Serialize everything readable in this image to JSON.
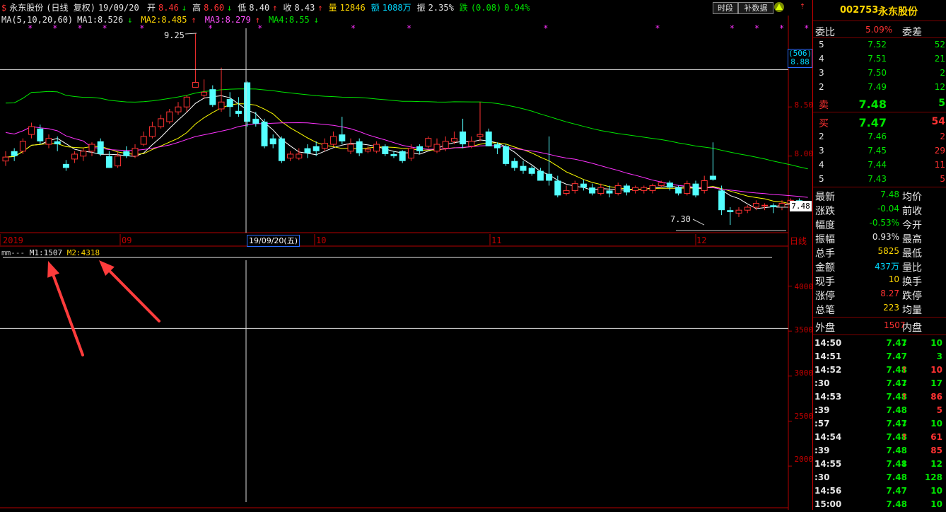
{
  "info": {
    "stock_name": "永东股份",
    "period": "(日线 复权)",
    "date": "19/09/20",
    "open_label": "开",
    "open": "8.46",
    "open_arrow": "↓",
    "high_label": "高",
    "high": "8.60",
    "high_arrow": "↓",
    "low_label": "低",
    "low": "8.40",
    "low_arrow": "↑",
    "close_label": "收",
    "close": "8.43",
    "close_arrow": "↑",
    "vol_label": "量",
    "vol": "12846",
    "amt_label": "额",
    "amt": "1088万",
    "amp_label": "振",
    "amp": "2.35%",
    "fall_label": "跌",
    "fall": "(0.08)",
    "fall_pct": "0.94%"
  },
  "ma_line": {
    "header": "MA(5,10,20,60)",
    "ma1": "MA1:8.526",
    "ma1_arrow": "↓",
    "ma2": "MA2:8.485",
    "ma2_arrow": "↑",
    "ma3": "MA3:8.279",
    "ma3_arrow": "↑",
    "ma4": "MA4:8.55",
    "ma4_arrow": "↓"
  },
  "buttons": {
    "time_share": "时段",
    "supplement": "补数据"
  },
  "price_annotations": {
    "high_mark": "9.25",
    "low_mark": "7.30",
    "cur_price": "7.48",
    "cursor_count": "(506)",
    "cursor_price": "8.88"
  },
  "price_axis": [
    "8.50",
    "8.00"
  ],
  "x_axis": {
    "year": "2019",
    "m09": "09",
    "cursor_date": "19/09/20(五)",
    "m10": "10",
    "m11": "11",
    "m12": "12",
    "mode": "日线"
  },
  "indicator": {
    "name": "mm---",
    "m1": "M1:1507",
    "m2": "M2:4318"
  },
  "vol_axis": [
    "4000",
    "3500",
    "3000",
    "2500",
    "2000"
  ],
  "right": {
    "code": "002753",
    "name": "永东股份",
    "weibi_label": "委比",
    "weibi": "5.09%",
    "weicha_label": "委差",
    "asks": [
      {
        "lvl": "5",
        "price": "7.52",
        "vol": "52"
      },
      {
        "lvl": "4",
        "price": "7.51",
        "vol": "21"
      },
      {
        "lvl": "3",
        "price": "7.50",
        "vol": "2"
      },
      {
        "lvl": "2",
        "price": "7.49",
        "vol": "12"
      },
      {
        "lvl": "卖",
        "price": "7.48",
        "vol": "5"
      }
    ],
    "bids": [
      {
        "lvl": "买",
        "price": "7.47",
        "vol": "54"
      },
      {
        "lvl": "2",
        "price": "7.46",
        "vol": "2"
      },
      {
        "lvl": "3",
        "price": "7.45",
        "vol": "29"
      },
      {
        "lvl": "4",
        "price": "7.44",
        "vol": "11"
      },
      {
        "lvl": "5",
        "price": "7.43",
        "vol": "5"
      }
    ],
    "stats": [
      {
        "l": "最新",
        "v": "7.48",
        "c": "green",
        "r": "均价"
      },
      {
        "l": "涨跌",
        "v": "-0.04",
        "c": "green",
        "r": "前收"
      },
      {
        "l": "幅度",
        "v": "-0.53%",
        "c": "green",
        "r": "今开"
      },
      {
        "l": "振幅",
        "v": "0.93%",
        "c": "white",
        "r": "最高"
      },
      {
        "l": "总手",
        "v": "5825",
        "c": "yellow",
        "r": "最低"
      },
      {
        "l": "金额",
        "v": "437万",
        "c": "cyan",
        "r": "量比"
      },
      {
        "l": "现手",
        "v": "10",
        "c": "yellow",
        "r": "换手"
      },
      {
        "l": "涨停",
        "v": "8.27",
        "c": "red",
        "r": "跌停"
      },
      {
        "l": "总笔",
        "v": "223",
        "c": "yellow",
        "r": "均量"
      }
    ],
    "outer_label": "外盘",
    "outer": "1507",
    "inner_label": "内盘",
    "ticks": [
      {
        "t": "14:50",
        "p": "7.47",
        "pc": "green",
        "a": "↓",
        "ac": "green",
        "v": "10",
        "vc": "green"
      },
      {
        "t": "14:51",
        "p": "7.47",
        "pc": "green",
        "a": "",
        "ac": "green",
        "v": "3",
        "vc": "green"
      },
      {
        "t": "14:52",
        "p": "7.48",
        "pc": "green",
        "a": "↑",
        "ac": "red",
        "v": "10",
        "vc": "red"
      },
      {
        "t": ":30",
        "p": "7.47",
        "pc": "green",
        "a": "↓",
        "ac": "green",
        "v": "17",
        "vc": "green"
      },
      {
        "t": "14:53",
        "p": "7.48",
        "pc": "green",
        "a": "↑",
        "ac": "red",
        "v": "86",
        "vc": "red"
      },
      {
        "t": ":39",
        "p": "7.48",
        "pc": "green",
        "a": "",
        "ac": "red",
        "v": "5",
        "vc": "red"
      },
      {
        "t": ":57",
        "p": "7.47",
        "pc": "green",
        "a": "↓",
        "ac": "green",
        "v": "10",
        "vc": "green"
      },
      {
        "t": "14:54",
        "p": "7.48",
        "pc": "green",
        "a": "↑",
        "ac": "red",
        "v": "61",
        "vc": "red"
      },
      {
        "t": ":39",
        "p": "7.48",
        "pc": "green",
        "a": "",
        "ac": "red",
        "v": "85",
        "vc": "red"
      },
      {
        "t": "14:55",
        "p": "7.48",
        "pc": "green",
        "a": "↓",
        "ac": "green",
        "v": "12",
        "vc": "green"
      },
      {
        "t": ":30",
        "p": "7.48",
        "pc": "green",
        "a": "",
        "ac": "green",
        "v": "128",
        "vc": "green"
      },
      {
        "t": "14:56",
        "p": "7.47",
        "pc": "green",
        "a": "",
        "ac": "green",
        "v": "10",
        "vc": "green"
      },
      {
        "t": "15:00",
        "p": "7.48",
        "pc": "green",
        "a": "",
        "ac": "green",
        "v": "10",
        "vc": "green"
      }
    ]
  },
  "colors": {
    "up": "#ff3232",
    "down": "#54ffff",
    "ma1": "#ffffff",
    "ma2": "#ffff00",
    "ma3": "#ff32ff",
    "ma4": "#00e600",
    "frame": "#b40000",
    "arrow": "#ff3c3c"
  },
  "chart_data": {
    "type": "candlestick",
    "ylim": [
      7.25,
      9.3
    ],
    "candles": [
      [
        7.95,
        7.99,
        7.9,
        8.05
      ],
      [
        8.05,
        8.0,
        7.95,
        8.08
      ],
      [
        8.05,
        8.15,
        8.02,
        8.18
      ],
      [
        8.22,
        8.3,
        8.18,
        8.34
      ],
      [
        8.28,
        8.15,
        8.12,
        8.32
      ],
      [
        8.12,
        8.18,
        8.08,
        8.22
      ],
      [
        8.15,
        8.12,
        8.05,
        8.2
      ],
      [
        7.92,
        7.88,
        7.85,
        7.96
      ],
      [
        7.97,
        8.02,
        7.93,
        8.05
      ],
      [
        8.0,
        8.05,
        7.95,
        8.08
      ],
      [
        8.05,
        8.12,
        8.0,
        8.14
      ],
      [
        8.15,
        8.02,
        8.0,
        8.18
      ],
      [
        8.0,
        7.88,
        7.88,
        8.05
      ],
      [
        7.9,
        8.0,
        7.88,
        8.04
      ],
      [
        8.05,
        8.0,
        7.98,
        8.1
      ],
      [
        8.0,
        8.08,
        7.98,
        8.12
      ],
      [
        8.12,
        8.2,
        8.1,
        8.25
      ],
      [
        8.2,
        8.3,
        8.18,
        8.35
      ],
      [
        8.3,
        8.38,
        8.28,
        8.42
      ],
      [
        8.35,
        8.45,
        8.33,
        8.48
      ],
      [
        8.45,
        8.5,
        8.42,
        8.55
      ],
      [
        8.5,
        8.6,
        8.45,
        8.62
      ],
      [
        8.7,
        8.75,
        8.7,
        9.25
      ],
      [
        8.62,
        8.65,
        8.58,
        8.78
      ],
      [
        8.68,
        8.52,
        8.5,
        8.72
      ],
      [
        8.48,
        8.55,
        8.45,
        8.9
      ],
      [
        8.58,
        8.5,
        8.4,
        8.65
      ],
      [
        8.46,
        8.43,
        8.4,
        8.6
      ],
      [
        8.75,
        8.35,
        8.3,
        8.76
      ],
      [
        8.38,
        8.33,
        8.3,
        8.45
      ],
      [
        8.35,
        8.1,
        8.08,
        8.38
      ],
      [
        8.18,
        8.12,
        8.08,
        8.22
      ],
      [
        8.18,
        7.95,
        7.93,
        8.2
      ],
      [
        7.98,
        8.02,
        7.95,
        8.05
      ],
      [
        7.98,
        8.02,
        7.96,
        8.08
      ],
      [
        8.08,
        8.03,
        7.98,
        8.12
      ],
      [
        8.1,
        8.05,
        8.0,
        8.15
      ],
      [
        8.08,
        8.13,
        8.05,
        8.18
      ],
      [
        8.12,
        8.2,
        8.1,
        8.25
      ],
      [
        8.22,
        8.15,
        8.12,
        8.4
      ],
      [
        8.05,
        8.12,
        8.02,
        8.18
      ],
      [
        8.15,
        8.03,
        8.0,
        8.18
      ],
      [
        8.05,
        8.07,
        8.03,
        8.1
      ],
      [
        8.05,
        8.12,
        8.03,
        8.15
      ],
      [
        8.1,
        8.02,
        8.0,
        8.12
      ],
      [
        8.02,
        8.0,
        7.98,
        8.05
      ],
      [
        8.05,
        7.95,
        7.93,
        8.06
      ],
      [
        7.98,
        8.08,
        7.95,
        8.12
      ],
      [
        8.1,
        8.05,
        8.02,
        8.12
      ],
      [
        8.1,
        8.18,
        8.08,
        8.2
      ],
      [
        8.05,
        8.12,
        8.03,
        8.18
      ],
      [
        8.08,
        8.15,
        8.05,
        8.2
      ],
      [
        8.15,
        8.18,
        8.12,
        8.25
      ],
      [
        8.25,
        8.12,
        8.08,
        8.38
      ],
      [
        8.1,
        8.15,
        8.08,
        8.2
      ],
      [
        8.2,
        8.22,
        8.15,
        8.55
      ],
      [
        8.25,
        8.1,
        8.1,
        8.28
      ],
      [
        8.12,
        8.08,
        8.02,
        8.14
      ],
      [
        8.1,
        7.92,
        7.9,
        8.12
      ],
      [
        7.95,
        7.88,
        7.85,
        7.98
      ],
      [
        7.9,
        7.85,
        7.82,
        7.95
      ],
      [
        7.88,
        7.82,
        7.8,
        7.9
      ],
      [
        7.85,
        7.75,
        7.75,
        7.88
      ],
      [
        7.82,
        7.75,
        7.7,
        8.2
      ],
      [
        7.75,
        7.6,
        7.58,
        7.8
      ],
      [
        7.62,
        7.65,
        7.6,
        7.7
      ],
      [
        7.65,
        7.72,
        7.62,
        7.75
      ],
      [
        7.72,
        7.68,
        7.65,
        7.76
      ],
      [
        7.68,
        7.62,
        7.6,
        7.72
      ],
      [
        7.62,
        7.68,
        7.6,
        7.72
      ],
      [
        7.65,
        7.62,
        7.58,
        7.7
      ],
      [
        7.62,
        7.7,
        7.6,
        7.73
      ],
      [
        7.7,
        7.63,
        7.6,
        7.72
      ],
      [
        7.65,
        7.68,
        7.62,
        7.7
      ],
      [
        7.65,
        7.68,
        7.62,
        7.7
      ],
      [
        7.65,
        7.7,
        7.62,
        7.72
      ],
      [
        7.7,
        7.73,
        7.68,
        7.75
      ],
      [
        7.73,
        7.68,
        7.65,
        7.75
      ],
      [
        7.68,
        7.62,
        7.6,
        7.7
      ],
      [
        7.62,
        7.72,
        7.6,
        7.75
      ],
      [
        7.72,
        7.6,
        7.58,
        7.75
      ],
      [
        7.65,
        7.75,
        7.62,
        7.8
      ],
      [
        7.8,
        7.76,
        7.75,
        8.14
      ],
      [
        7.65,
        7.45,
        7.4,
        7.7
      ],
      [
        7.45,
        7.43,
        7.3,
        7.48
      ],
      [
        7.42,
        7.45,
        7.38,
        7.48
      ],
      [
        7.45,
        7.48,
        7.42,
        7.5
      ],
      [
        7.48,
        7.52,
        7.45,
        7.55
      ],
      [
        7.5,
        7.5,
        7.45,
        7.52
      ],
      [
        7.5,
        7.48,
        7.42,
        7.52
      ],
      [
        7.48,
        7.52,
        7.45,
        7.55
      ],
      [
        7.52,
        7.55,
        7.48,
        7.57
      ],
      [
        7.55,
        7.5,
        7.47,
        7.57
      ],
      [
        7.5,
        7.48,
        7.46,
        7.52
      ]
    ],
    "ma_last": {
      "MA1": 8.526,
      "MA2": 8.485,
      "MA3": 8.279,
      "MA4": 8.55
    },
    "markers": [
      0.8,
      1.6,
      2.4,
      3.2,
      4.4,
      6.6,
      8.2,
      11.2,
      13.0,
      17.4,
      21.0,
      23.4,
      24.2,
      25.0,
      25.8,
      28.2,
      31.4,
      34.6,
      37.8,
      38.6
    ],
    "indicator": {
      "M1": 1507,
      "M2": 4318,
      "ylim": [
        1600,
        4350
      ],
      "ticks": [
        4000,
        3500,
        3000,
        2500,
        2000
      ]
    }
  }
}
